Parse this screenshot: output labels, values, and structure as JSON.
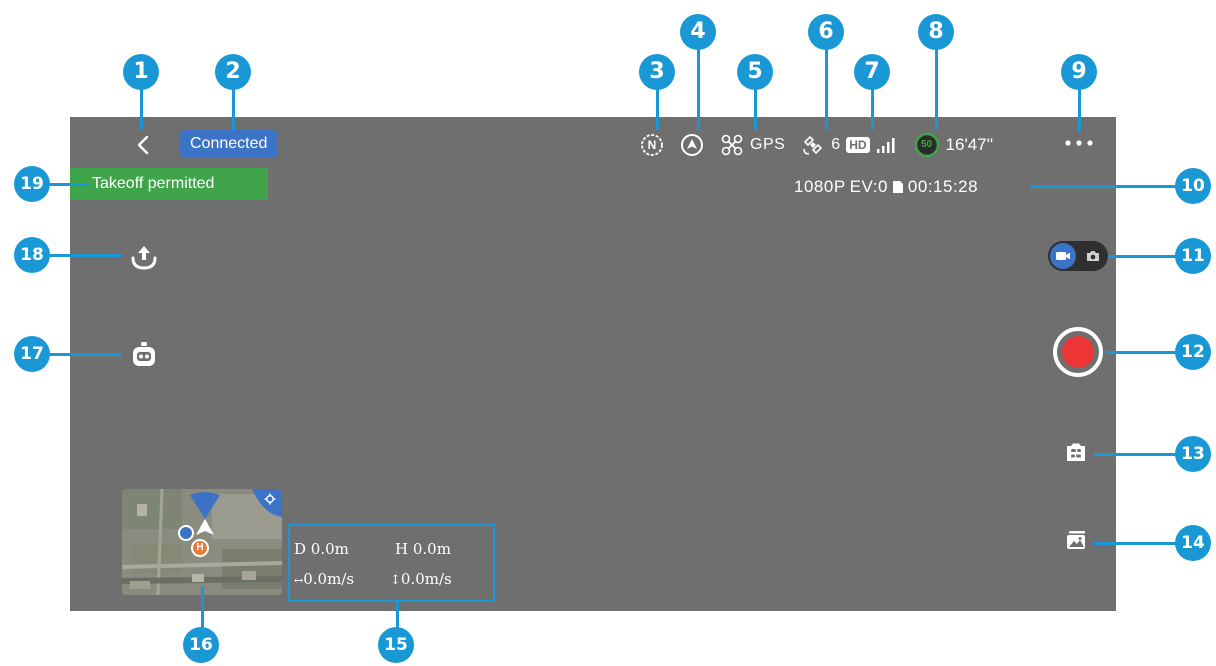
{
  "header": {
    "connection_status": "Connected"
  },
  "status_bar": {
    "compass_letter": "N",
    "positioning_mode": "GPS",
    "satellite_count": "6",
    "video_quality_badge": "HD",
    "battery_level": "50",
    "flight_time_remaining": "16'47''"
  },
  "banner": {
    "takeoff_status": "Takeoff permitted"
  },
  "video": {
    "resolution": "1080P",
    "exposure": "EV:0",
    "recording_time": "00:15:28"
  },
  "telemetry": {
    "distance": "D 0.0m",
    "height": "H 0.0m",
    "horizontal_speed": "0.0m/s",
    "vertical_speed": "0.0m/s"
  },
  "minimap": {
    "home_marker": "H"
  },
  "callouts": [
    "1",
    "2",
    "3",
    "4",
    "5",
    "6",
    "7",
    "8",
    "9",
    "10",
    "11",
    "12",
    "13",
    "14",
    "15",
    "16",
    "17",
    "18",
    "19"
  ],
  "colors": {
    "screen_bg": "#6f6f70",
    "callout": "#1a98d5",
    "connected_badge": "#3b74c6",
    "takeoff_badge": "#3fa44a",
    "record": "#ec3535",
    "battery_ring": "#3fa44a"
  },
  "icons": {
    "back": "chevron-left-icon",
    "compass": "compass-icon",
    "navigation": "navigation-arrow-icon",
    "drone": "drone-icon",
    "satellite": "satellite-icon",
    "signal": "signal-bars-icon",
    "battery": "battery-ring-icon",
    "more": "more-dots-icon",
    "sd_card": "sd-card-icon",
    "video_mode": "video-camera-icon",
    "photo_mode": "photo-camera-icon",
    "record": "record-icon",
    "camera_settings": "camera-settings-icon",
    "gallery": "gallery-icon",
    "takeoff": "takeoff-icon",
    "smart_flight": "robot-icon",
    "map_locate": "locate-icon"
  }
}
